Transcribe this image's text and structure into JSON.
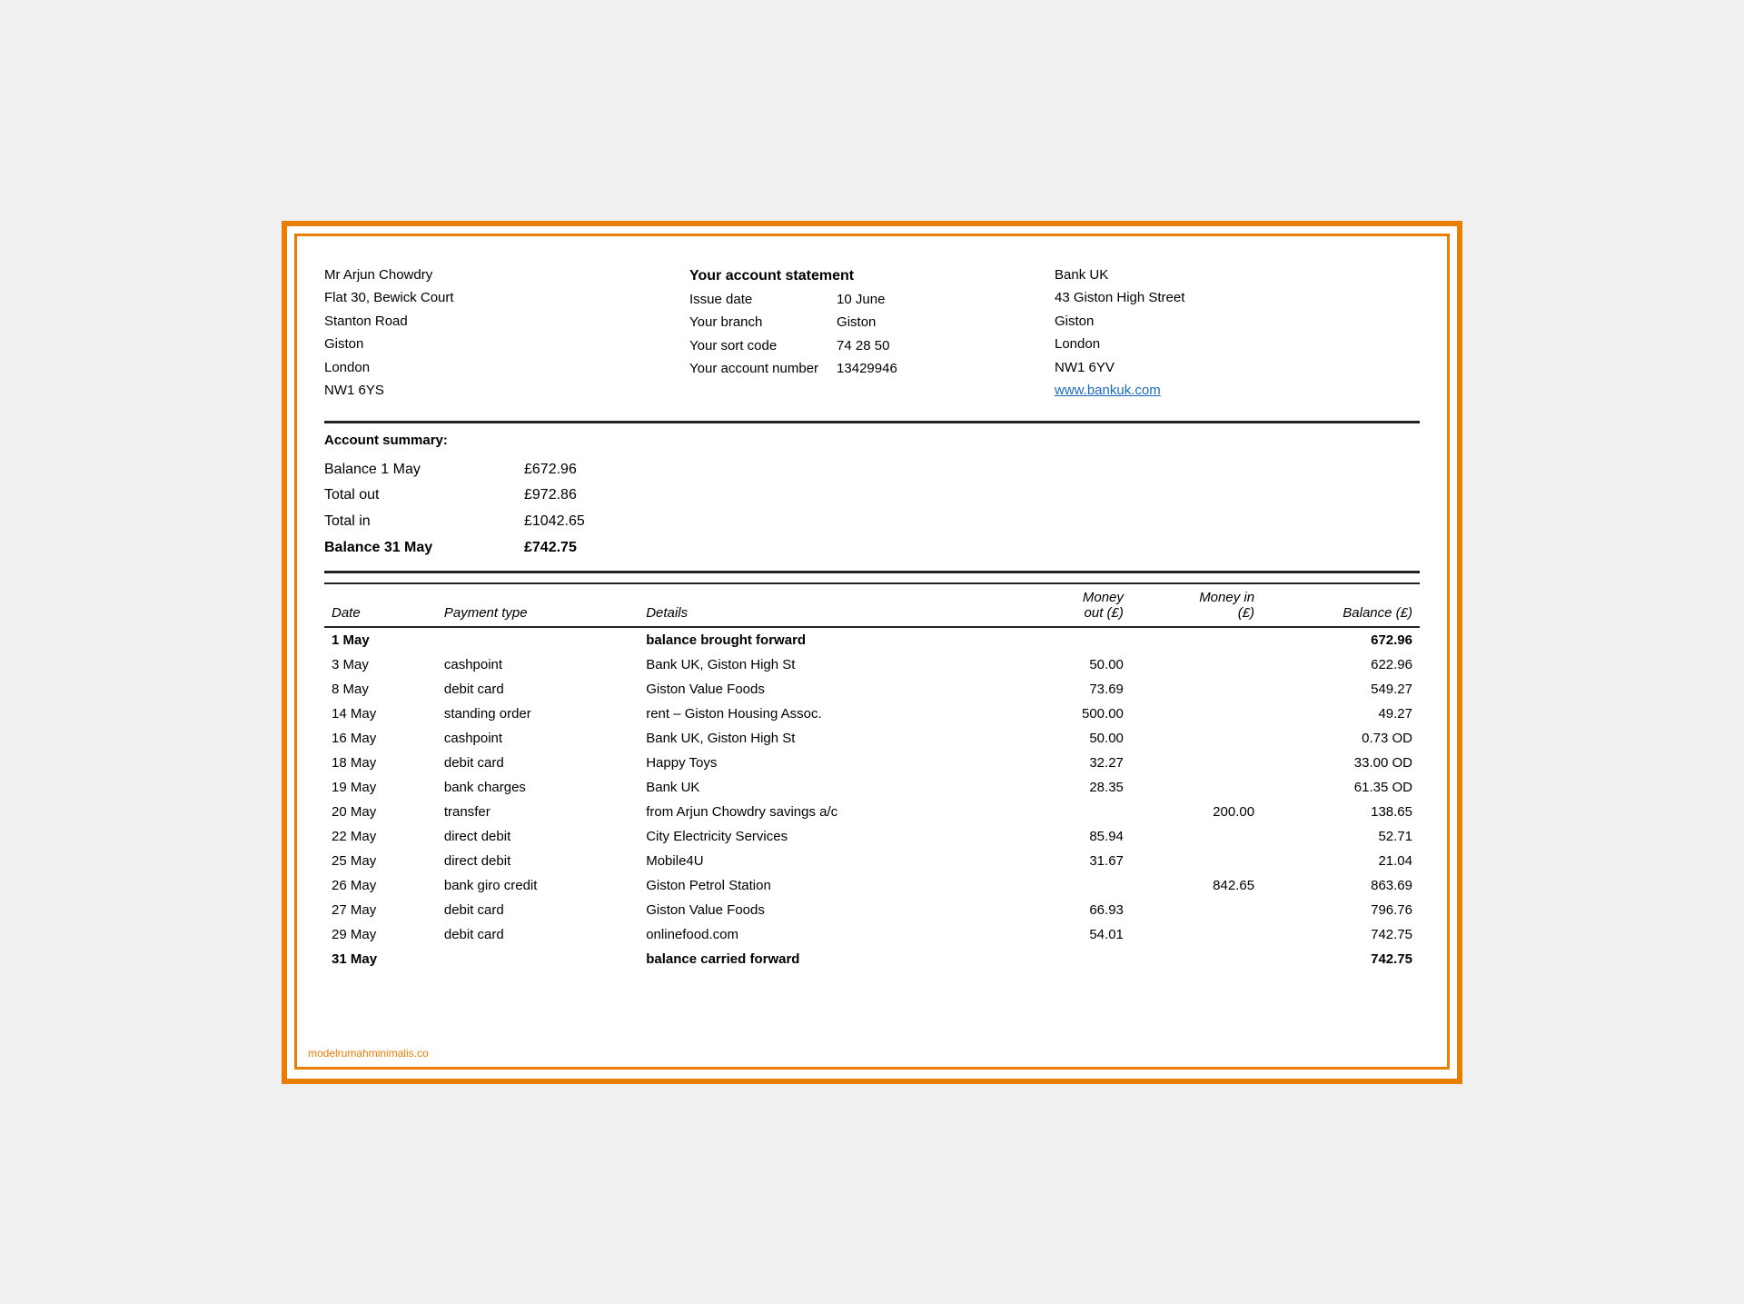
{
  "customer": {
    "name": "Mr Arjun Chowdry",
    "address_line1": "Flat 30, Bewick Court",
    "address_line2": "Stanton Road",
    "address_line3": "Giston",
    "address_line4": "London",
    "address_line5": "NW1 6YS"
  },
  "statement": {
    "title": "Your account statement",
    "issue_label": "Issue date",
    "issue_value": "10 June",
    "branch_label": "Your branch",
    "branch_value": "Giston",
    "sort_code_label": "Your sort code",
    "sort_code_value": "74 28 50",
    "account_label": "Your account number",
    "account_value": "13429946"
  },
  "bank": {
    "name": "Bank UK",
    "address_line1": "43 Giston High Street",
    "address_line2": "Giston",
    "address_line3": "London",
    "address_line4": "NW1 6YV",
    "website": "www.bankuk.com"
  },
  "summary": {
    "title": "Account summary:",
    "rows": [
      {
        "label": "Balance 1 May",
        "value": "£672.96",
        "bold": false
      },
      {
        "label": "Total out",
        "value": "£972.86",
        "bold": false
      },
      {
        "label": "Total in",
        "value": "£1042.65",
        "bold": false
      },
      {
        "label": "Balance 31 May",
        "value": "£742.75",
        "bold": true
      }
    ]
  },
  "table": {
    "headers": {
      "date": "Date",
      "payment_type": "Payment type",
      "details": "Details",
      "money_out": "Money out (£)",
      "money_in": "Money in (£)",
      "balance": "Balance (£)"
    },
    "rows": [
      {
        "date": "1 May",
        "payment_type": "",
        "details": "balance brought forward",
        "money_out": "",
        "money_in": "",
        "balance": "672.96",
        "bold": true
      },
      {
        "date": "3 May",
        "payment_type": "cashpoint",
        "details": "Bank UK, Giston High St",
        "money_out": "50.00",
        "money_in": "",
        "balance": "622.96",
        "bold": false
      },
      {
        "date": "8 May",
        "payment_type": "debit card",
        "details": "Giston Value Foods",
        "money_out": "73.69",
        "money_in": "",
        "balance": "549.27",
        "bold": false
      },
      {
        "date": "14 May",
        "payment_type": "standing order",
        "details": "rent – Giston Housing Assoc.",
        "money_out": "500.00",
        "money_in": "",
        "balance": "49.27",
        "bold": false
      },
      {
        "date": "16 May",
        "payment_type": "cashpoint",
        "details": "Bank UK, Giston High St",
        "money_out": "50.00",
        "money_in": "",
        "balance": "0.73 OD",
        "bold": false
      },
      {
        "date": "18 May",
        "payment_type": "debit card",
        "details": "Happy Toys",
        "money_out": "32.27",
        "money_in": "",
        "balance": "33.00 OD",
        "bold": false
      },
      {
        "date": "19 May",
        "payment_type": "bank charges",
        "details": "Bank UK",
        "money_out": "28.35",
        "money_in": "",
        "balance": "61.35 OD",
        "bold": false
      },
      {
        "date": "20 May",
        "payment_type": "transfer",
        "details": "from Arjun Chowdry savings a/c",
        "money_out": "",
        "money_in": "200.00",
        "balance": "138.65",
        "bold": false
      },
      {
        "date": "22 May",
        "payment_type": "direct debit",
        "details": "City Electricity Services",
        "money_out": "85.94",
        "money_in": "",
        "balance": "52.71",
        "bold": false
      },
      {
        "date": "25 May",
        "payment_type": "direct debit",
        "details": "Mobile4U",
        "money_out": "31.67",
        "money_in": "",
        "balance": "21.04",
        "bold": false
      },
      {
        "date": "26 May",
        "payment_type": "bank giro credit",
        "details": "Giston Petrol Station",
        "money_out": "",
        "money_in": "842.65",
        "balance": "863.69",
        "bold": false
      },
      {
        "date": "27 May",
        "payment_type": "debit card",
        "details": "Giston Value Foods",
        "money_out": "66.93",
        "money_in": "",
        "balance": "796.76",
        "bold": false
      },
      {
        "date": "29 May",
        "payment_type": "debit card",
        "details": "onlinefood.com",
        "money_out": "54.01",
        "money_in": "",
        "balance": "742.75",
        "bold": false
      },
      {
        "date": "31 May",
        "payment_type": "",
        "details": "balance carried forward",
        "money_out": "",
        "money_in": "",
        "balance": "742.75",
        "bold": true
      }
    ]
  },
  "footer": {
    "watermark": "modelrumahminimalis.co"
  }
}
